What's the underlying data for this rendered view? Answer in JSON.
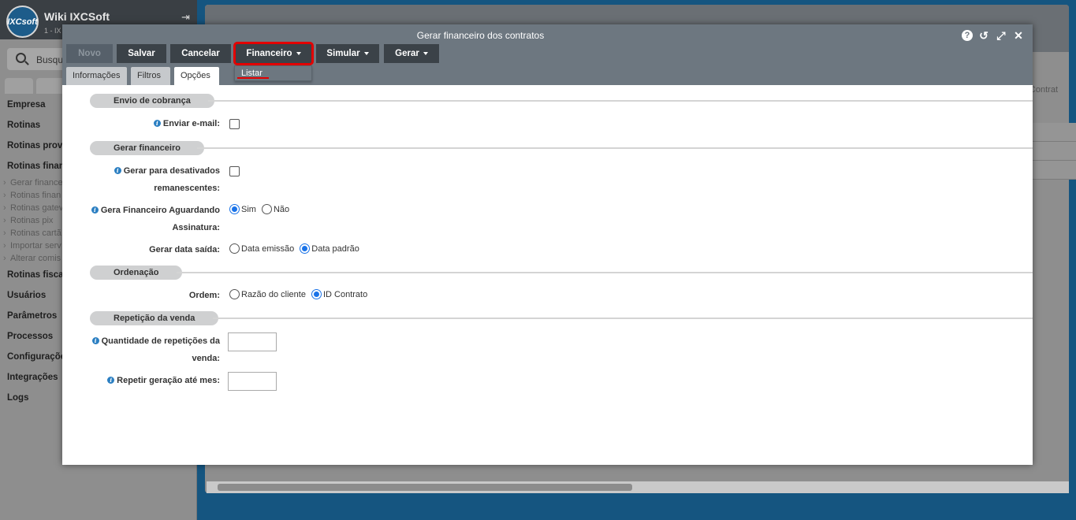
{
  "background": {
    "app_name": "Wiki IXCSoft",
    "app_sub": "1 - IX",
    "logo_text": "IXCsoft",
    "search_placeholder": "Busqu",
    "nav": [
      {
        "label": "Empresa",
        "type": "main"
      },
      {
        "label": "Rotinas",
        "type": "main"
      },
      {
        "label": "Rotinas prove",
        "type": "main"
      },
      {
        "label": "Rotinas finan",
        "type": "main"
      },
      {
        "label": "Gerar finance",
        "type": "sub"
      },
      {
        "label": "Rotinas finan",
        "type": "sub"
      },
      {
        "label": "Rotinas gatev",
        "type": "sub"
      },
      {
        "label": "Rotinas pix",
        "type": "sub"
      },
      {
        "label": "Rotinas cartã",
        "type": "sub"
      },
      {
        "label": "Importar serv",
        "type": "sub"
      },
      {
        "label": "Alterar comis",
        "type": "sub"
      },
      {
        "label": "Rotinas fisca",
        "type": "main"
      },
      {
        "label": "Usuários",
        "type": "main"
      },
      {
        "label": "Parâmetros",
        "type": "main"
      },
      {
        "label": "Processos",
        "type": "main"
      },
      {
        "label": "Configuraçõe",
        "type": "main"
      },
      {
        "label": "Integrações",
        "type": "main"
      },
      {
        "label": "Logs",
        "type": "main"
      }
    ],
    "contrat_header": "Contrat"
  },
  "modal": {
    "title": "Gerar financeiro dos contratos",
    "toolbar": {
      "novo": "Novo",
      "salvar": "Salvar",
      "cancelar": "Cancelar",
      "financeiro": "Financeiro",
      "simular": "Simular",
      "gerar": "Gerar"
    },
    "dropdown": {
      "listar": "Listar"
    },
    "tabs": [
      "Informações",
      "Filtros",
      "Opções"
    ],
    "active_tab": "Opções",
    "sections": {
      "envio": "Envio de cobrança",
      "gerar": "Gerar financeiro",
      "ordenacao": "Ordenação",
      "repeticao": "Repetição da venda"
    },
    "fields": {
      "enviar_email": "Enviar e-mail:",
      "desativados_1": "Gerar para desativados",
      "desativados_2": "remanescentes:",
      "aguardando_1": "Gera Financeiro Aguardando",
      "aguardando_2": "Assinatura:",
      "sim": "Sim",
      "nao": "Não",
      "data_saida": "Gerar data saída:",
      "data_emissao": "Data emissão",
      "data_padrao": "Data padrão",
      "ordem": "Ordem:",
      "razao": "Razão do cliente",
      "id_contrato": "ID Contrato",
      "qtd_1": "Quantidade de repetições da",
      "qtd_2": "venda:",
      "repetir": "Repetir geração até mes:"
    }
  }
}
